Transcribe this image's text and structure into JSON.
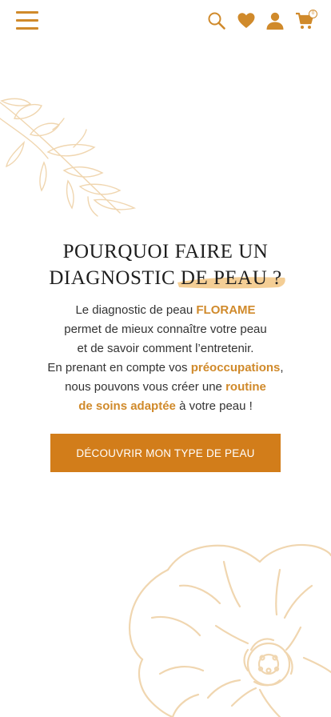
{
  "header": {
    "icons": [
      "menu-icon",
      "search-icon",
      "heart-icon",
      "user-icon",
      "cart-icon"
    ],
    "cart_count": "0"
  },
  "title": {
    "line1": "POURQUOI FAIRE UN",
    "line2_a": "DIAGNOSTIC",
    "line2_b": "DE PEAU ?"
  },
  "description": {
    "p1_a": "Le diagnostic de peau ",
    "brand": "FLORAME",
    "p2": "permet de mieux connaître votre peau",
    "p3": "et de savoir comment l’entretenir.",
    "p4_a": "En prenant en compte vos ",
    "concerns": "préoccupations",
    "p4_b": ",",
    "p5_a": "nous pouvons vous créer une ",
    "routine_1": "routine",
    "routine_2": "de soins adaptée",
    "p6_b": " à votre peau !"
  },
  "cta": {
    "label": "DÉCOUVRIR MON TYPE DE PEAU"
  },
  "colors": {
    "accent": "#d08a2b",
    "button": "#d27d1a",
    "decor": "#f0d6b0"
  }
}
